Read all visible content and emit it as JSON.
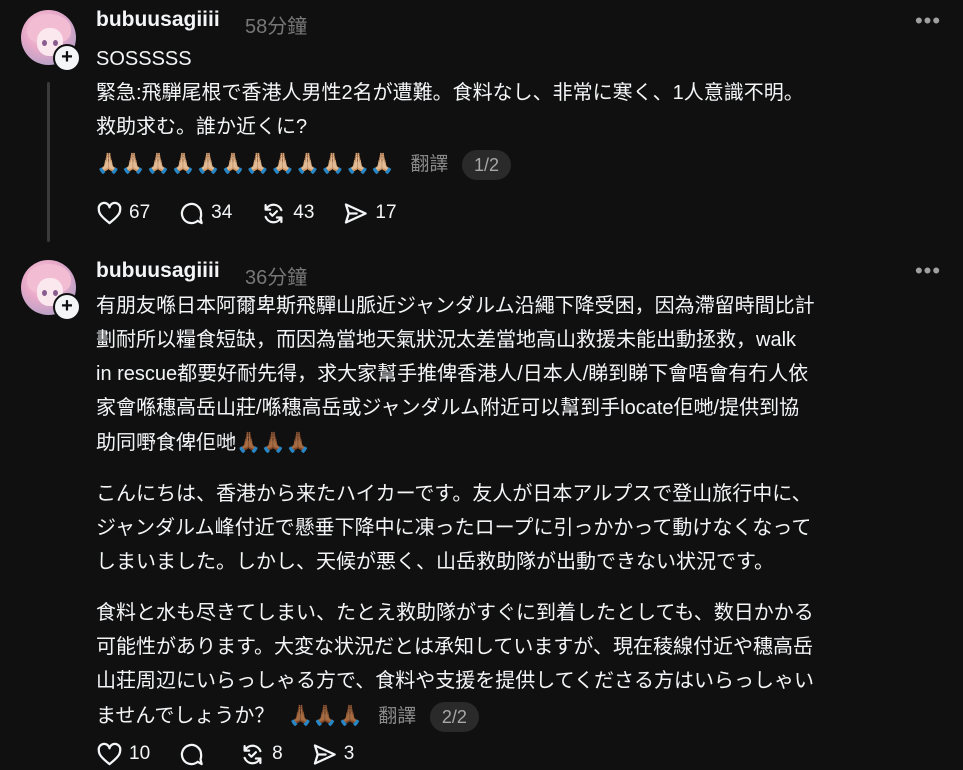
{
  "posts": [
    {
      "username": "bubuusagiiii",
      "time": "58分鐘",
      "lines": [
        "SOSSSSS",
        "緊急:飛騨尾根で香港人男性2名が遭難。食料なし、非常に寒く、1人意識不明。",
        "救助求む。誰か近くに?"
      ],
      "emoji_row": "🙏🏼🙏🏼🙏🏼🙏🏼🙏🏼🙏🏼🙏🏼🙏🏼🙏🏼🙏🏼🙏🏼🙏🏼",
      "translate_label": "翻譯",
      "page_indicator": "1/2",
      "likes": "67",
      "comments": "34",
      "reposts": "43",
      "shares": "17"
    },
    {
      "username": "bubuusagiiii",
      "time": "36分鐘",
      "para1": [
        "有朋友喺日本阿爾卑斯飛驒山脈近ジャンダルム沿繩下降受困，因為滯留時間比計",
        "劃耐所以糧食短缺，而因為當地天氣狀況太差當地高山救援未能出動拯救，walk",
        "in rescue都要好耐先得，求大家幫手推俾香港人/日本人/睇到睇下會唔會有冇人依",
        "家會喺穗高岳山莊/喺穗高岳或ジャンダルム附近可以幫到手locate佢哋/提供到協",
        "助同嘢食俾佢哋"
      ],
      "para1_emoji": "🙏🏾🙏🏾🙏🏾",
      "para2": [
        "こんにちは、香港から来たハイカーです。友人が日本アルプスで登山旅行中に、",
        "ジャンダルム峰付近で懸垂下降中に凍ったロープに引っかかって動けなくなって",
        "しまいました。しかし、天候が悪く、山岳救助隊が出動できない状況です。"
      ],
      "para3": [
        "食料と水も尽きてしまい、たとえ救助隊がすぐに到着したとしても、数日かかる",
        "可能性があります。大変な状況だとは承知していますが、現在稜線付近や穗高岳",
        "山荘周辺にいらっしゃる方で、食料や支援を提供してくださる方はいらっしゃい",
        "ませんでしょうか？"
      ],
      "para3_emoji": "🙏🏾🙏🏾🙏🏾",
      "translate_label": "翻譯",
      "page_indicator": "2/2",
      "likes": "10",
      "comments": "",
      "reposts": "8",
      "shares": "3"
    }
  ],
  "more_glyph": "•••",
  "plus_glyph": "+",
  "icons": {
    "like": "heart-icon",
    "comment": "comment-icon",
    "repost": "repost-icon",
    "share": "share-icon",
    "more": "more-icon",
    "follow": "plus-icon"
  }
}
